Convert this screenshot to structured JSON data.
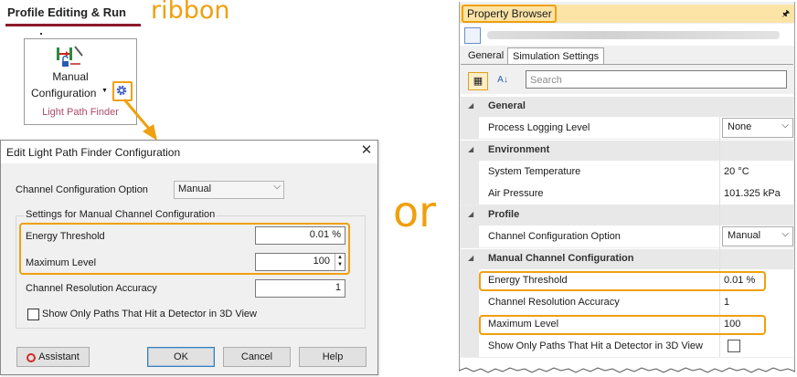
{
  "ribbon": {
    "tab_label": "Profile Editing & Run",
    "annotation_word": "ribbon",
    "button_line1": "Manual",
    "button_line2": "Configuration",
    "group_label": "Light Path Finder"
  },
  "dialog": {
    "title": "Edit Light Path Finder Configuration",
    "channel_option_label": "Channel Configuration Option",
    "channel_option_value": "Manual",
    "group_title": "Settings for Manual Channel Configuration",
    "energy_threshold_label": "Energy Threshold",
    "energy_threshold_value": "0.01 %",
    "maximum_level_label": "Maximum Level",
    "maximum_level_value": "100",
    "resolution_label": "Channel Resolution Accuracy",
    "resolution_value": "1",
    "show_only_paths_label": "Show Only Paths That Hit a Detector in 3D View",
    "assistant_button": "Assistant",
    "ok_button": "OK",
    "cancel_button": "Cancel",
    "help_button": "Help"
  },
  "separator_word": "or",
  "property_browser": {
    "title": "Property Browser",
    "pin_icon": "ℵ",
    "tabs": [
      "General",
      "Simulation Settings"
    ],
    "search_placeholder": "Search",
    "categories": {
      "general": "General",
      "environment": "Environment",
      "profile": "Profile",
      "manual": "Manual Channel Configuration"
    },
    "rows": {
      "process_logging_label": "Process Logging Level",
      "process_logging_value": "None",
      "system_temperature_label": "System Temperature",
      "system_temperature_value": "20 °C",
      "air_pressure_label": "Air Pressure",
      "air_pressure_value": "101.325 kPa",
      "channel_option_label": "Channel Configuration Option",
      "channel_option_value": "Manual",
      "energy_threshold_label": "Energy Threshold",
      "energy_threshold_value": "0.01 %",
      "resolution_label": "Channel Resolution Accuracy",
      "resolution_value": "1",
      "maximum_level_label": "Maximum Level",
      "maximum_level_value": "100",
      "show_only_paths_label": "Show Only Paths That Hit a Detector in 3D View"
    }
  },
  "colors": {
    "highlight": "#f0a00e",
    "ribbon_underline": "#8b1a2b",
    "pb_header": "#fce4a6",
    "group_label": "#b04a6a"
  }
}
